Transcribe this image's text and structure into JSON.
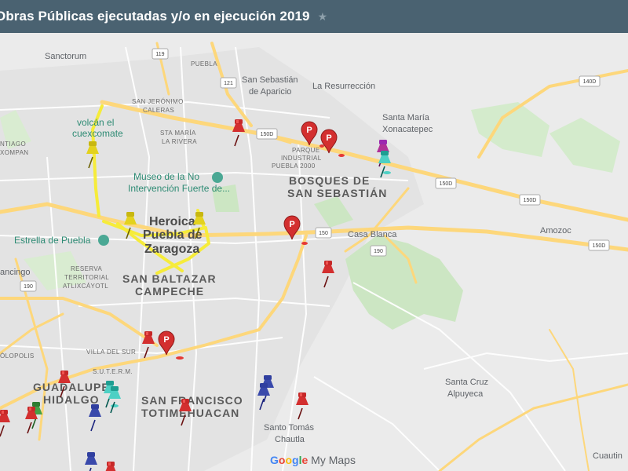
{
  "header": {
    "title": "Obras Públicas ejecutadas y/o en ejecución 2019",
    "star_icon": "star-icon"
  },
  "brand": {
    "google": "Google",
    "product": "My Maps"
  },
  "labels": {
    "sanctorum": "Sanctorum",
    "sanjeronimo1": "SAN JERÓNIMO",
    "sanjeronimo2": "CALERAS",
    "puebla_road": "PUEBLA",
    "sansebastian1": "San Sebastián",
    "sansebastian2": "de Aparicio",
    "resurreccion": "La Resurrección",
    "santamaria1": "Santa María",
    "santamaria2": "Xonacatepec",
    "volcan1": "volcán el",
    "volcan2": "cuexcomate",
    "tiago1": "NTIAGO",
    "tiago2": "XOMPAN",
    "starivera1": "STA MARÍA",
    "starivera2": "LA RIVERA",
    "parque1": "PARQUE",
    "parque2": "INDUSTRIAL",
    "parque3": "PUEBLA 2000",
    "bosques1": "BOSQUES DE",
    "bosques2": "SAN SEBASTIÁN",
    "museo1": "Museo de la No",
    "museo2": "Intervención Fuerte de...",
    "heroica1": "Heroica",
    "heroica2": "Puebla de",
    "heroica3": "Zaragoza",
    "estrella": "Estrella de Puebla",
    "casablanca": "Casa Blanca",
    "amozoc": "Amozoc",
    "ancingo": "ancingo",
    "reserva1": "RESERVA",
    "reserva2": "TERRITORIAL",
    "reserva3": "ATLIXCÁYOTL",
    "baltazar1": "SAN BALTAZAR",
    "baltazar2": "CAMPECHE",
    "villadelsur": "VILLA DEL SUR",
    "stes": "S.U.T.E.R.M.",
    "guadalupe1": "GUADALUPE",
    "guadalupe2": "HIDALGO",
    "olopolis": "ÓLOPOLIS",
    "sanfrancisco1": "SAN FRANCISCO",
    "sanfrancisco2": "TOTIMEHUACAN",
    "santatomas1": "Santo Tomás",
    "santatomas2": "Chautla",
    "santacruz1": "Santa Cruz",
    "santacruz2": "Alpuyeca",
    "cuautin": "Cuautin",
    "s119": "119",
    "s121": "121",
    "s140d": "140D",
    "s150d_a": "150D",
    "s150d_b": "150D",
    "s150d_c": "150D",
    "s150d_d": "150D",
    "s150": "150",
    "s190a": "190",
    "s190b": "190"
  },
  "colors": {
    "topbar": "#4a6271",
    "road_yellow": "#fdd77b",
    "route_yellow": "#f6ec3a",
    "park_green": "#cce6c3",
    "pin_red": "#c62828",
    "pin_yellow": "#d4c21c",
    "pin_blue": "#3f51b5",
    "pin_teal": "#26a69a",
    "pin_green": "#43a047",
    "pin_magenta": "#b03097"
  }
}
